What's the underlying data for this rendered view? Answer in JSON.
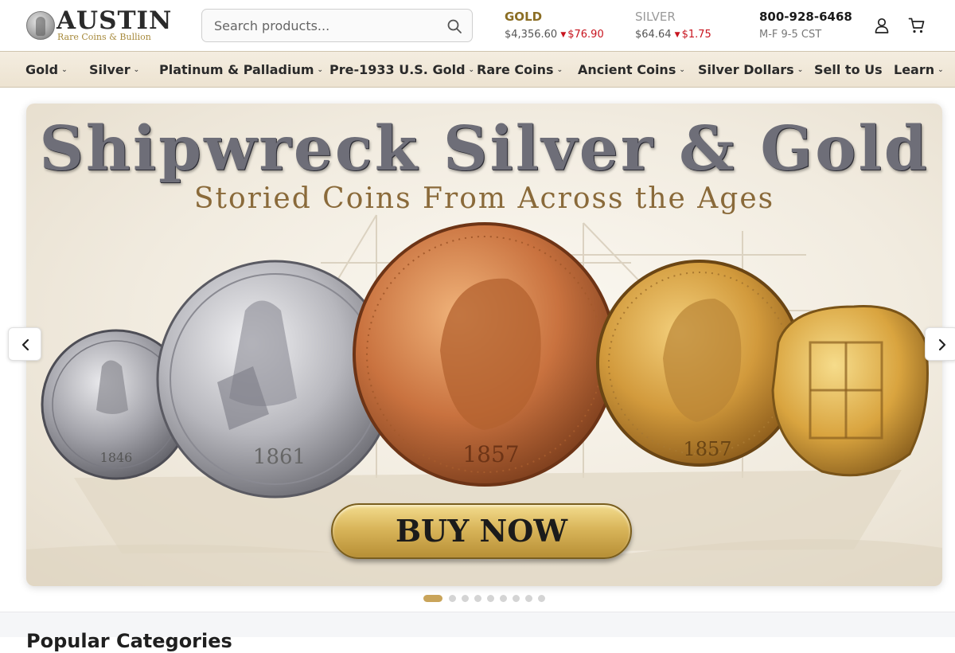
{
  "header": {
    "logo_word": "AUSTIN",
    "logo_sub": "Rare Coins & Bullion",
    "search_placeholder": "Search products...",
    "gold": {
      "label": "GOLD",
      "price": "$4,356.60",
      "change": "$76.90"
    },
    "silver": {
      "label": "SILVER",
      "price": "$64.64",
      "change": "$1.75"
    },
    "phone": "800-928-6468",
    "hours": "M-F 9-5 CST",
    "icons": [
      "search-icon",
      "account-icon",
      "cart-icon"
    ]
  },
  "nav": {
    "items": [
      {
        "label": "Gold",
        "dropdown": true
      },
      {
        "label": "Silver",
        "dropdown": true
      },
      {
        "label": "Platinum & Palladium",
        "dropdown": true
      },
      {
        "label": "Pre-1933 U.S. Gold",
        "dropdown": true
      },
      {
        "label": "Rare Coins",
        "dropdown": true
      },
      {
        "label": "Ancient Coins",
        "dropdown": true
      },
      {
        "label": "Silver Dollars",
        "dropdown": true
      },
      {
        "label": "Sell to Us",
        "dropdown": false
      },
      {
        "label": "Learn",
        "dropdown": true
      }
    ]
  },
  "banner": {
    "title": "Shipwreck Silver & Gold",
    "subtitle": "Storied Coins From Across the Ages",
    "cta": "BUY NOW",
    "coin_dates": [
      "1846",
      "1861",
      "1857",
      "1857"
    ],
    "slide_count": 9,
    "active_slide": 1
  },
  "section": {
    "title": "Popular Categories"
  },
  "colors": {
    "accent_gold": "#8b6e24",
    "price_down": "#c8141e",
    "nav_bg": "#f0e7d6",
    "dot_active": "#c9a45a"
  }
}
